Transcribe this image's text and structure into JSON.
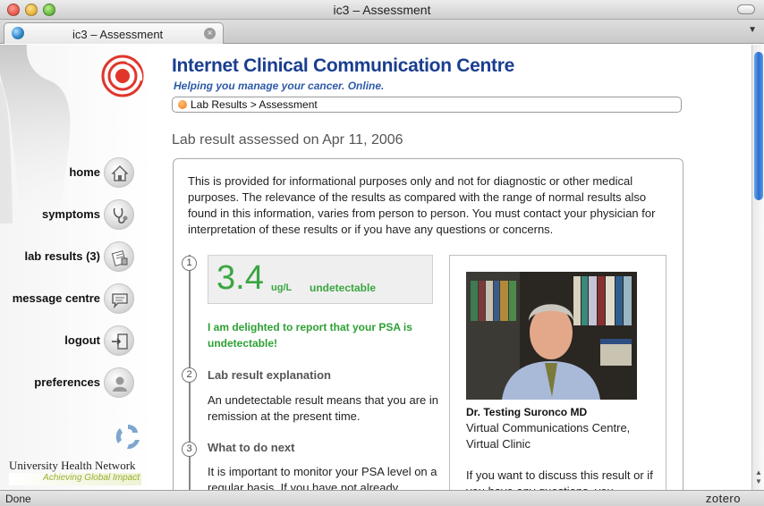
{
  "window": {
    "title": "ic3 – Assessment"
  },
  "tab": {
    "label": "ic3 – Assessment",
    "close_glyph": "×"
  },
  "site": {
    "title": "Internet Clinical Communication Centre",
    "tagline": "Helping you manage your cancer. Online."
  },
  "breadcrumb": {
    "path": "Lab Results > Assessment"
  },
  "nav": {
    "items": [
      {
        "label": "home",
        "icon": "house-icon"
      },
      {
        "label": "symptoms",
        "icon": "stethoscope-icon"
      },
      {
        "label": "lab results (3)",
        "icon": "lab-report-icon"
      },
      {
        "label": "message centre",
        "icon": "speech-bubble-icon"
      },
      {
        "label": "logout",
        "icon": "exit-door-icon"
      },
      {
        "label": "preferences",
        "icon": "person-icon"
      }
    ]
  },
  "org": {
    "name": "University Health Network",
    "tagline": "Achieving Global Impact"
  },
  "page": {
    "heading": "Lab result assessed on Apr 11, 2006",
    "intro": "This is provided for informational purposes only and not for diagnostic or other medical purposes. The relevance of the results as compared with the range of normal results also found in this information, varies from person to person. You must contact your physician for interpretation of these results or if you have any questions or concerns."
  },
  "result": {
    "step": "1",
    "value": "3.4",
    "unit": "ug/L",
    "status": "undetectable",
    "message": "I am delighted to report that your PSA is undetectable!"
  },
  "explanation": {
    "step": "2",
    "title": "Lab result explanation",
    "body": "An undetectable result means that you are in remission at the present time."
  },
  "next": {
    "step": "3",
    "title": "What to do next",
    "body": "It is important to monitor your PSA level on a regular basis. If you have not already"
  },
  "doctor": {
    "name": "Dr. Testing Suronco MD",
    "affiliation": "Virtual Communications Centre, Virtual Clinic",
    "note": "If you want to discuss this result or if you have any questions, you"
  },
  "statusbar": {
    "status": "Done",
    "addon": "zotero"
  },
  "colors": {
    "brand_blue": "#1a3e8f",
    "result_green": "#3aa641",
    "accent_orange": "#f07a12"
  }
}
